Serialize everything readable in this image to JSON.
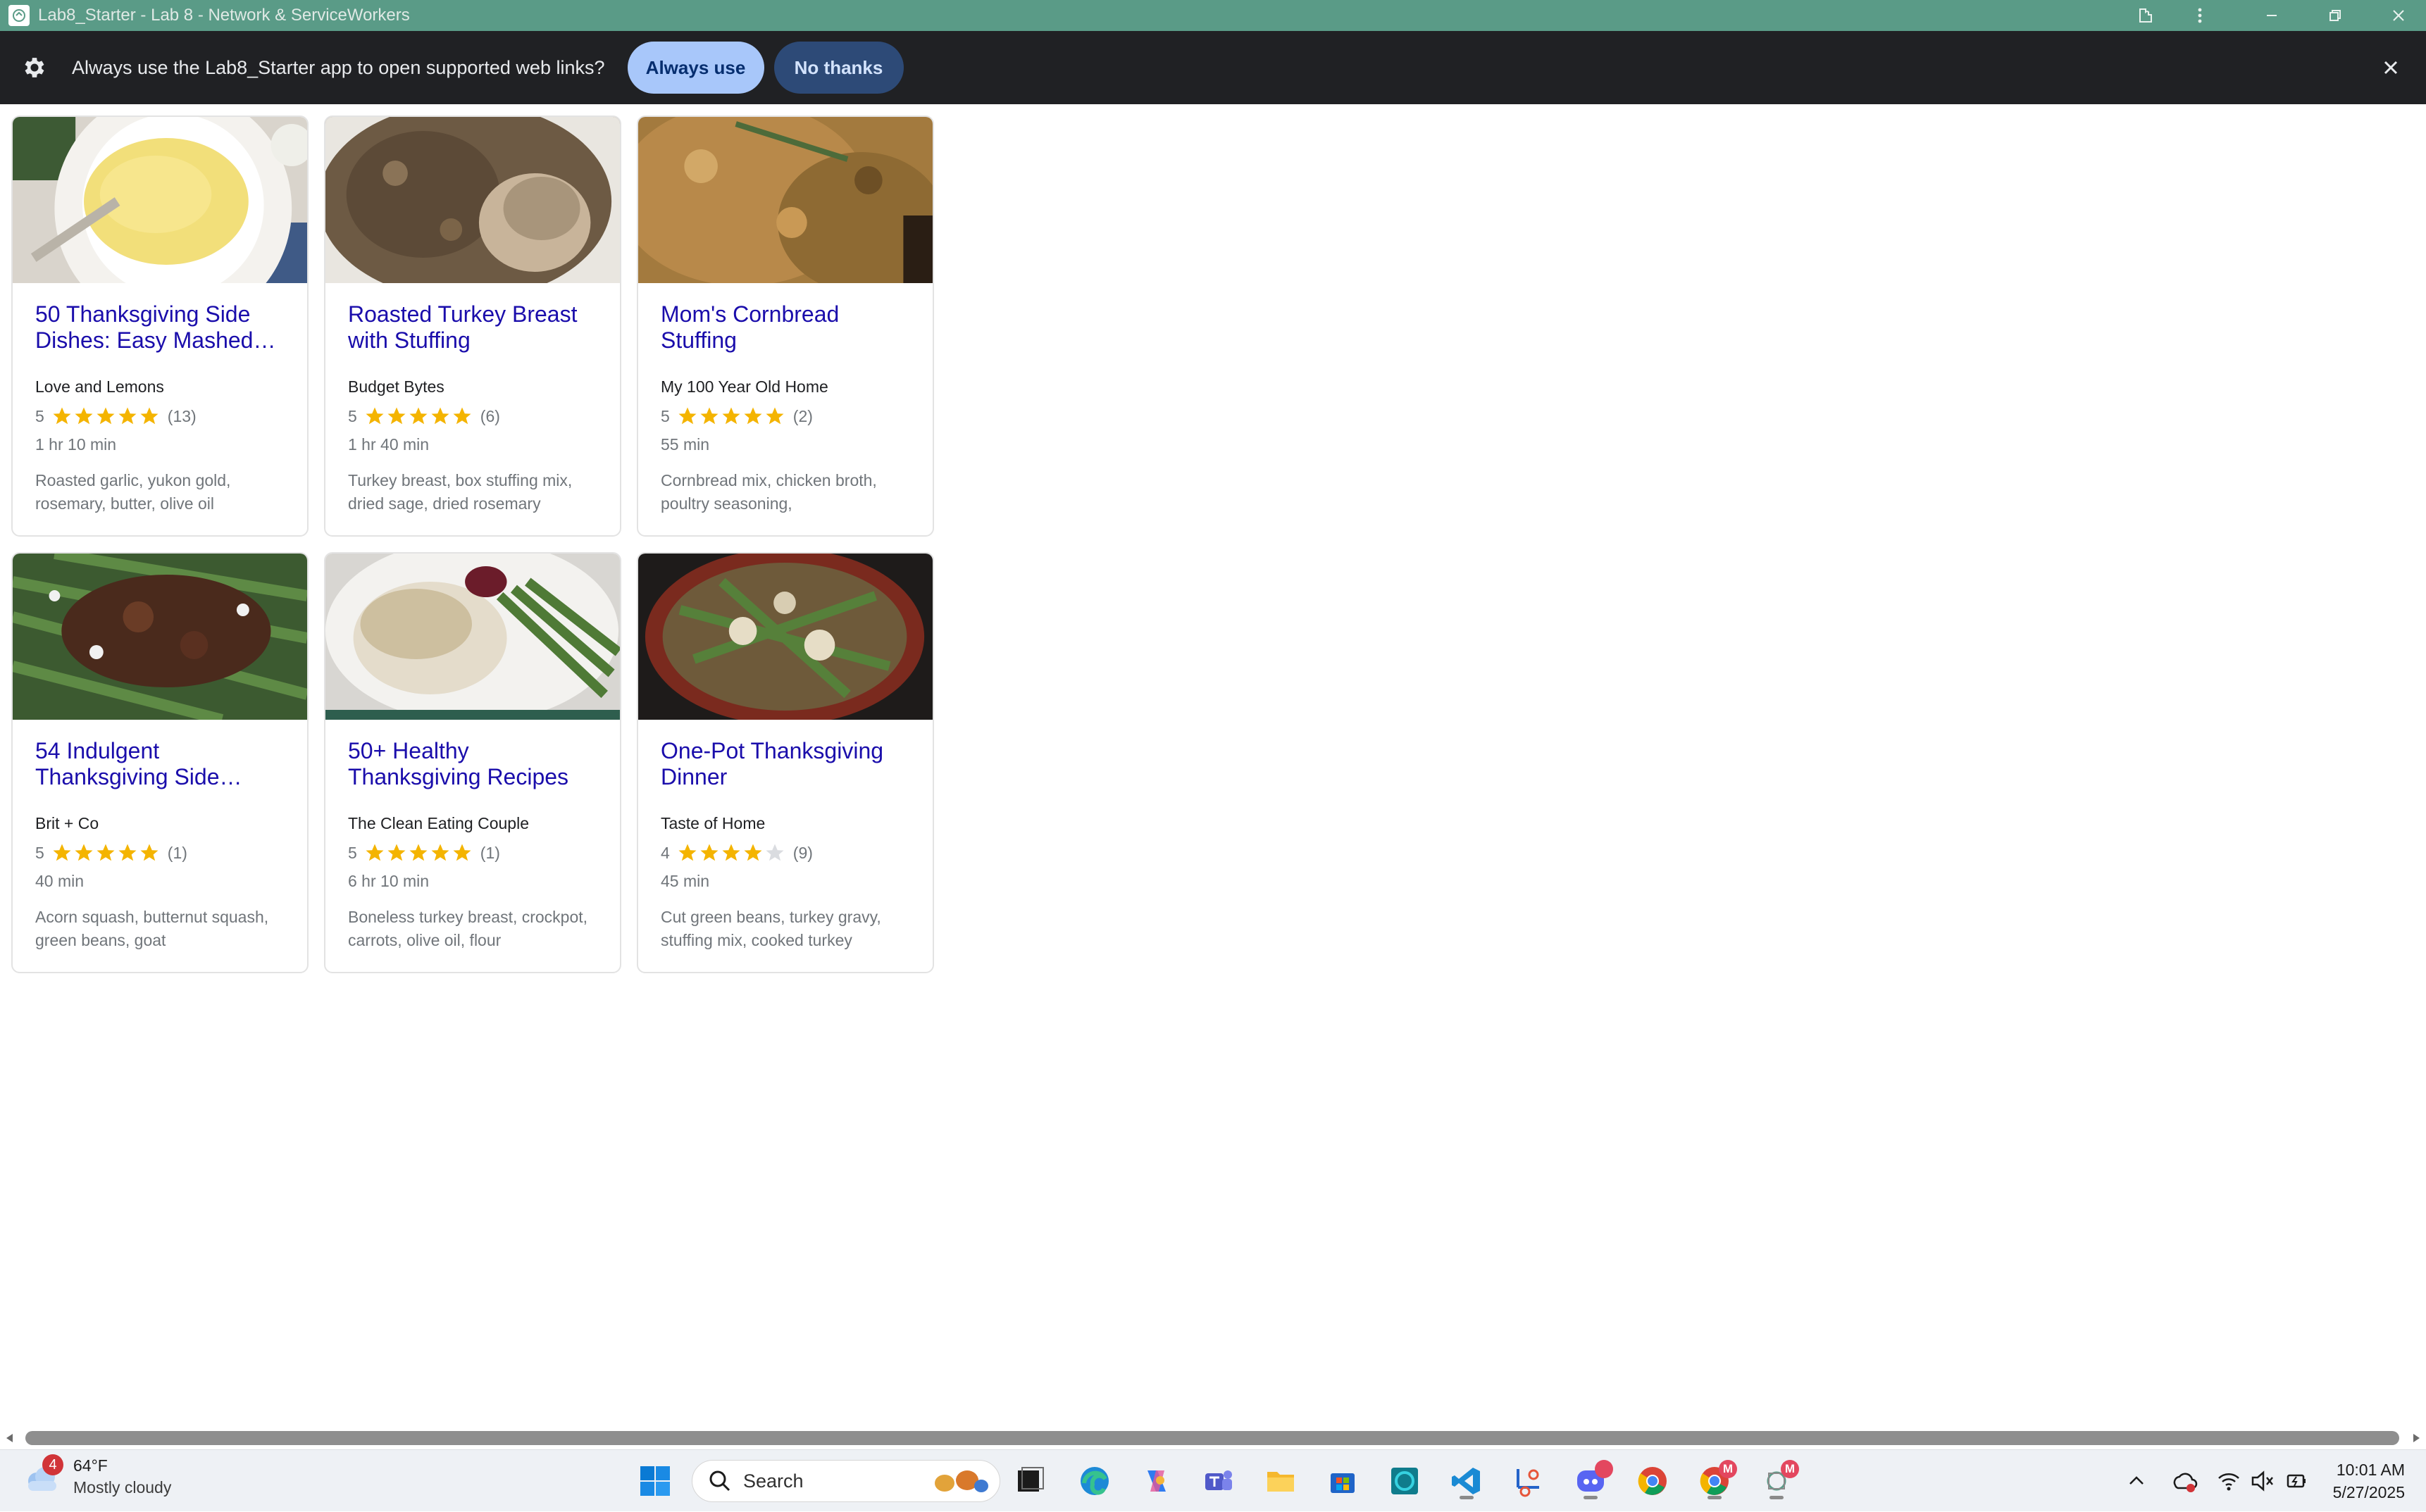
{
  "window": {
    "title": "Lab8_Starter - Lab 8 - Network & ServiceWorkers"
  },
  "infobar": {
    "message": "Always use the Lab8_Starter app to open supported web links?",
    "always_use_label": "Always use",
    "no_thanks_label": "No thanks"
  },
  "recipes": [
    {
      "title": "50 Thanksgiving Side Dishes: Easy Mashed…",
      "source": "Love and Lemons",
      "rating": 5,
      "rating_label": "5",
      "reviews": "(13)",
      "time": "1 hr 10 min",
      "ingredients": "Roasted garlic, yukon gold, rosemary, butter, olive oil",
      "image": "mashed-potatoes"
    },
    {
      "title": "Roasted Turkey Breast with Stuffing",
      "source": "Budget Bytes",
      "rating": 5,
      "rating_label": "5",
      "reviews": "(6)",
      "time": "1 hr 40 min",
      "ingredients": "Turkey breast, box stuffing mix, dried sage, dried rosemary",
      "image": "turkey-stuffing"
    },
    {
      "title": "Mom's Cornbread Stuffing",
      "source": "My 100 Year Old Home",
      "rating": 5,
      "rating_label": "5",
      "reviews": "(2)",
      "time": "55 min",
      "ingredients": "Cornbread mix, chicken broth, poultry seasoning,",
      "image": "cornbread-stuffing"
    },
    {
      "title": "54 Indulgent Thanksgiving Side…",
      "source": "Brit + Co",
      "rating": 5,
      "rating_label": "5",
      "reviews": "(1)",
      "time": "40 min",
      "ingredients": "Acorn squash, butternut squash, green beans, goat",
      "image": "green-beans-pecans"
    },
    {
      "title": "50+ Healthy Thanksgiving Recipes",
      "source": "The Clean Eating Couple",
      "rating": 5,
      "rating_label": "5",
      "reviews": "(1)",
      "time": "6 hr 10 min",
      "ingredients": "Boneless turkey breast, crockpot, carrots, olive oil, flour",
      "image": "turkey-plate"
    },
    {
      "title": "One-Pot Thanksgiving Dinner",
      "source": "Taste of Home",
      "rating": 4,
      "rating_label": "4",
      "reviews": "(9)",
      "time": "45 min",
      "ingredients": "Cut green beans, turkey gravy, stuffing mix, cooked turkey",
      "image": "one-pot-dinner"
    }
  ],
  "taskbar": {
    "weather_badge": "4",
    "weather_temp": "64°F",
    "weather_condition": "Mostly cloudy",
    "search_label": "Search",
    "discord_badge": "",
    "chrome_profile_badge": "M",
    "app_badge": "M",
    "time": "10:01 AM",
    "date": "5/27/2025"
  },
  "colors": {
    "titlebar": "#5a9b87",
    "infobar": "#202124",
    "link": "#1a0dab",
    "star": "#f4b400"
  }
}
